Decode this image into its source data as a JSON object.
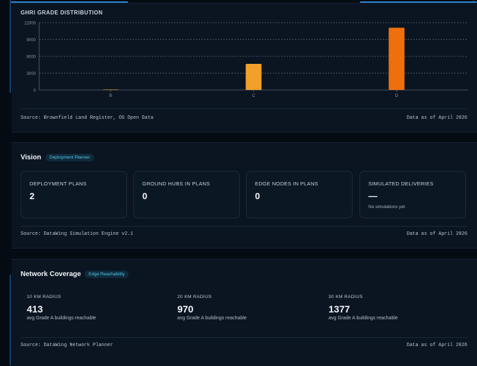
{
  "grade_panel": {
    "title": "GHRI GRADE DISTRIBUTION",
    "source": "Source: Brownfield Land Register, OS Open Data",
    "as_of": "Data as of April 2026"
  },
  "chart_data": {
    "type": "bar",
    "categories": [
      "B",
      "C",
      "D"
    ],
    "values": [
      80,
      4650,
      11100
    ],
    "bar_colors": [
      "#e89a24",
      "#f2a029",
      "#ef6f0c"
    ],
    "ylim": [
      0,
      12000
    ],
    "yticks": [
      "0",
      "3000",
      "6000",
      "9000",
      "12000"
    ],
    "xlabel": "",
    "ylabel": "",
    "grid": true
  },
  "vision": {
    "title": "Vision",
    "badge": "Deployment Planner",
    "cards": [
      {
        "label": "DEPLOYMENT PLANS",
        "value": "2",
        "sub": ""
      },
      {
        "label": "GROUND HUBS IN PLANS",
        "value": "0",
        "sub": ""
      },
      {
        "label": "EDGE NODES IN PLANS",
        "value": "0",
        "sub": ""
      },
      {
        "label": "SIMULATED DELIVERIES",
        "value": "—",
        "sub": "No simulations yet"
      }
    ],
    "source": "Source: DataWing Simulation Engine v2.1",
    "as_of": "Data as of April 2026"
  },
  "coverage": {
    "title": "Network Coverage",
    "badge": "Edge Reachability",
    "stats": [
      {
        "label": "10 KM RADIUS",
        "value": "413",
        "sub": "avg Grade A buildings reachable"
      },
      {
        "label": "20 KM RADIUS",
        "value": "970",
        "sub": "avg Grade A buildings reachable"
      },
      {
        "label": "30 KM RADIUS",
        "value": "1377",
        "sub": "avg Grade A buildings reachable"
      }
    ],
    "source": "Source: DataWing Network Planner",
    "as_of": "Data as of April 2026"
  },
  "colors": {
    "background": "#050b13",
    "panel": "#0b1521",
    "accent_blue": "#2f86d6",
    "badge_text": "#52c6e8"
  }
}
